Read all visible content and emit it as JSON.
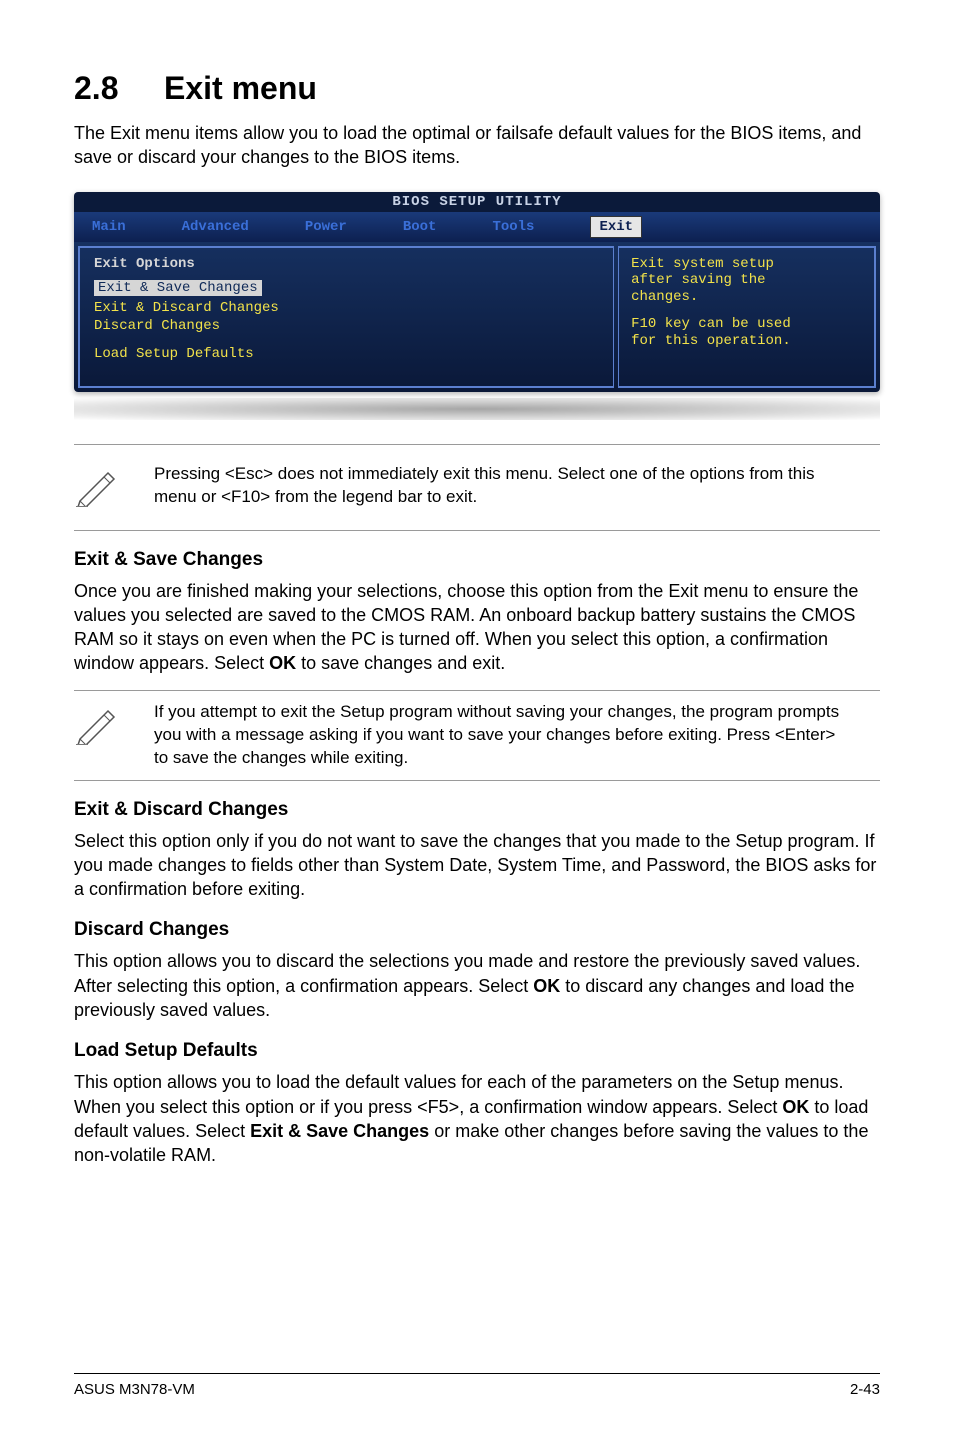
{
  "section": {
    "number": "2.8",
    "title": "Exit menu"
  },
  "intro": "The Exit menu items allow you to load the optimal or failsafe default values for the BIOS items, and save or discard your changes to the BIOS items.",
  "bios": {
    "utility_title": "BIOS SETUP UTILITY",
    "tabs": {
      "main": "Main",
      "advanced": "Advanced",
      "power": "Power",
      "boot": "Boot",
      "tools": "Tools",
      "exit": "Exit"
    },
    "left": {
      "header": "Exit Options",
      "items": {
        "save": "Exit & Save Changes",
        "discard_exit": "Exit & Discard Changes",
        "discard": "Discard Changes",
        "load_defaults": "Load Setup Defaults"
      }
    },
    "right": {
      "line1": "Exit system setup",
      "line2": "after saving the",
      "line3": "changes.",
      "line4": "F10 key can be used",
      "line5": "for this operation."
    }
  },
  "note1": "Pressing <Esc> does not immediately exit this menu. Select one of the options from this menu or <F10> from the legend bar to exit.",
  "sections": {
    "exit_save": {
      "heading": "Exit & Save Changes",
      "p1a": "Once you are finished making your selections, choose this option from the Exit menu to ensure the values you selected are saved to the CMOS RAM. An onboard backup battery sustains the CMOS RAM so it stays on even when the PC is turned off. When you select this option, a confirmation window appears. Select ",
      "p1b": "OK",
      "p1c": " to save changes and exit."
    },
    "note2": " If you attempt to exit the Setup program without saving your changes, the program prompts you with a message asking if you want to save your changes before exiting. Press <Enter>  to save the  changes while exiting.",
    "exit_discard": {
      "heading": "Exit & Discard Changes",
      "p": "Select this option only if you do not want to save the changes that you  made to the Setup program. If you made changes to fields other than System Date, System Time, and Password, the BIOS asks for a confirmation before exiting."
    },
    "discard": {
      "heading": "Discard Changes",
      "p1a": "This option allows you to discard the selections you made and restore the previously saved values. After selecting this option, a confirmation appears. Select ",
      "p1b": "OK",
      "p1c": " to discard any changes and load the previously saved values."
    },
    "load_defaults": {
      "heading": "Load Setup Defaults",
      "p1a": "This option allows you to load the default values for each of the parameters on the Setup menus. When you select this option or if you press <F5>, a confirmation window appears. Select ",
      "p1b": "OK",
      "p1c": " to load default values. Select ",
      "p1d": "Exit & Save Changes",
      "p1e": " or make other changes before saving the values to the non-volatile RAM."
    }
  },
  "footer": {
    "left": "ASUS M3N78-VM",
    "right": "2-43"
  }
}
